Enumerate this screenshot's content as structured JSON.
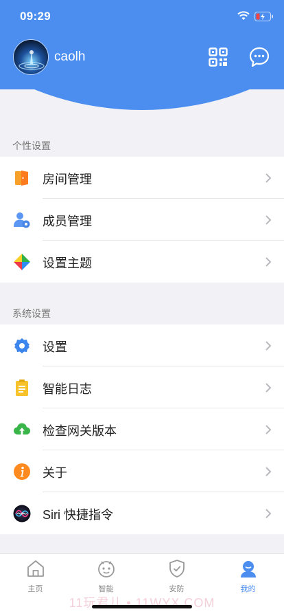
{
  "status": {
    "time": "09:29"
  },
  "profile": {
    "username": "caolh"
  },
  "sections": [
    {
      "title": "个性设置",
      "items": [
        {
          "label": "房间管理",
          "icon": "door-icon"
        },
        {
          "label": "成员管理",
          "icon": "members-icon"
        },
        {
          "label": "设置主题",
          "icon": "theme-icon"
        }
      ]
    },
    {
      "title": "系统设置",
      "items": [
        {
          "label": "设置",
          "icon": "gear-icon"
        },
        {
          "label": "智能日志",
          "icon": "clipboard-icon"
        },
        {
          "label": "检查网关版本",
          "icon": "cloud-upload-icon"
        },
        {
          "label": "关于",
          "icon": "info-icon"
        },
        {
          "label": "Siri 快捷指令",
          "icon": "siri-icon"
        }
      ]
    }
  ],
  "tabs": [
    {
      "label": "主页",
      "icon": "home-icon",
      "active": false
    },
    {
      "label": "智能",
      "icon": "robot-icon",
      "active": false
    },
    {
      "label": "安防",
      "icon": "shield-icon",
      "active": false
    },
    {
      "label": "我的",
      "icon": "profile-icon",
      "active": true
    }
  ],
  "watermark": "11玩君儿 • 11WYX.COM",
  "colors": {
    "accent": "#4b8ef0",
    "background": "#f2f2f6"
  }
}
